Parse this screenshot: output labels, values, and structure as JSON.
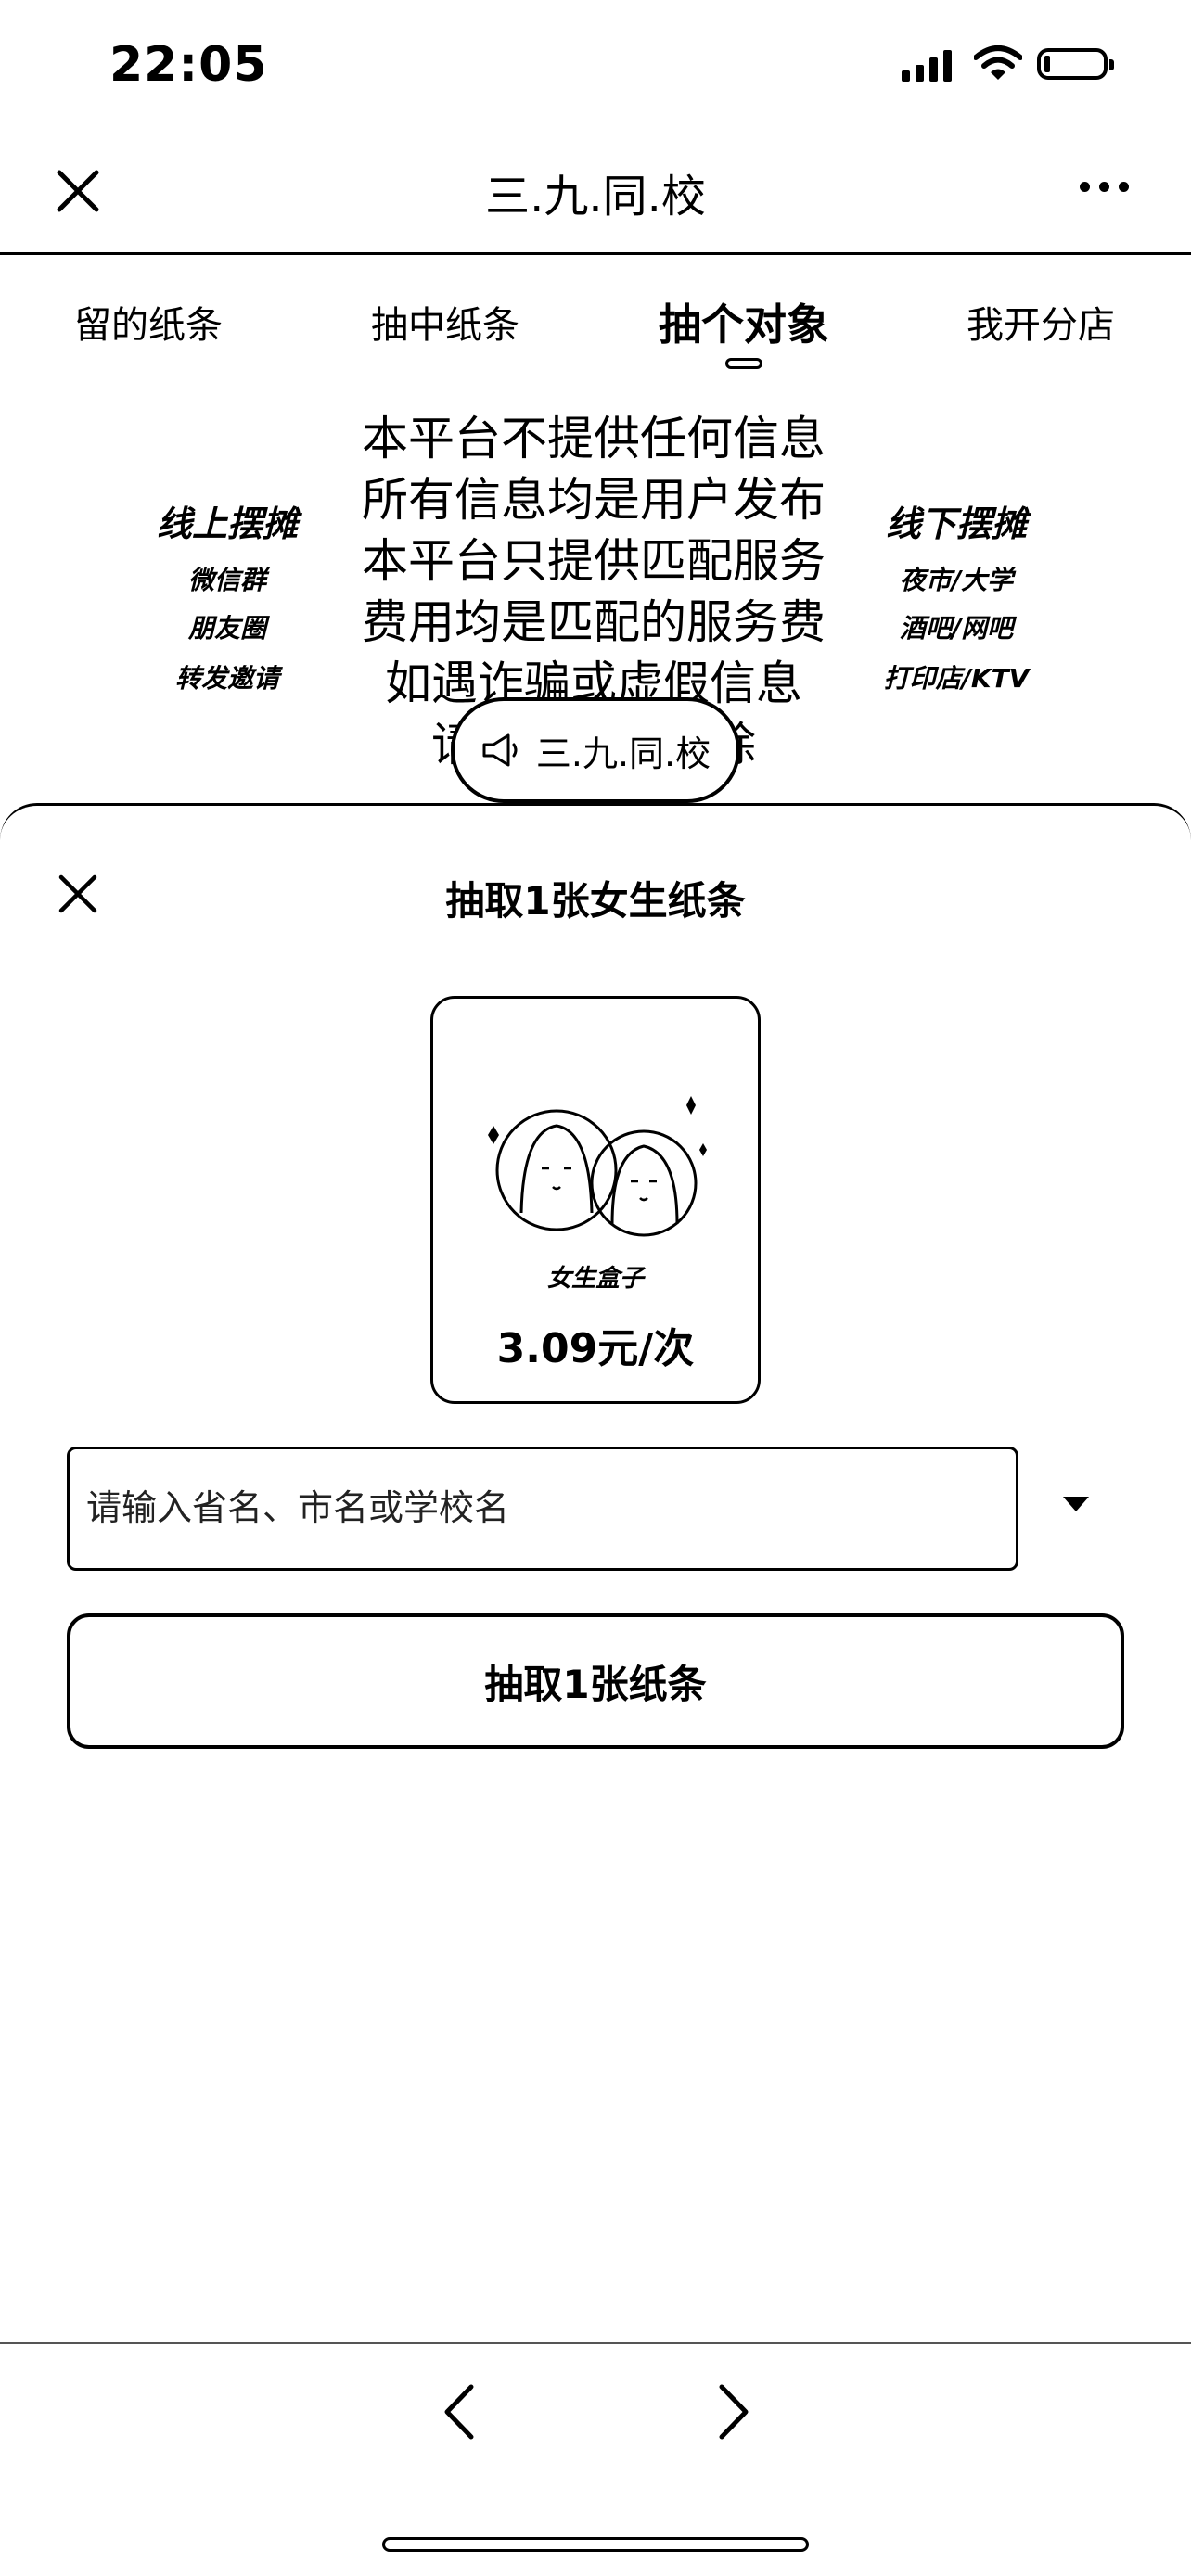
{
  "status_bar": {
    "time": "22:05"
  },
  "nav": {
    "title": "三.九.同.校"
  },
  "tabs": [
    {
      "label": "留的纸条"
    },
    {
      "label": "抽中纸条"
    },
    {
      "label": "抽个对象",
      "active": true
    },
    {
      "label": "我开分店"
    }
  ],
  "banner": {
    "lines": [
      "本平台不提供任何信息",
      "所有信息均是用户发布",
      "本平台只提供匹配服务",
      "费用均是匹配的服务费",
      "如遇诈骗或虚假信息",
      "请联系客服删除"
    ],
    "left": {
      "title": "线上摆摊",
      "items": [
        "微信群",
        "朋友圈",
        "转发邀请"
      ]
    },
    "right": {
      "title": "线下摆摊",
      "items": [
        "夜市/大学",
        "酒吧/网吧",
        "打印店/KTV"
      ]
    },
    "pill_label": "三.九.同.校"
  },
  "sheet": {
    "title": "抽取1张女生纸条",
    "card": {
      "name": "女生盒子",
      "price": "3.09元/次"
    },
    "search": {
      "placeholder": "请输入省名、市名或学校名",
      "value": ""
    },
    "draw_button": "抽取1张纸条"
  }
}
